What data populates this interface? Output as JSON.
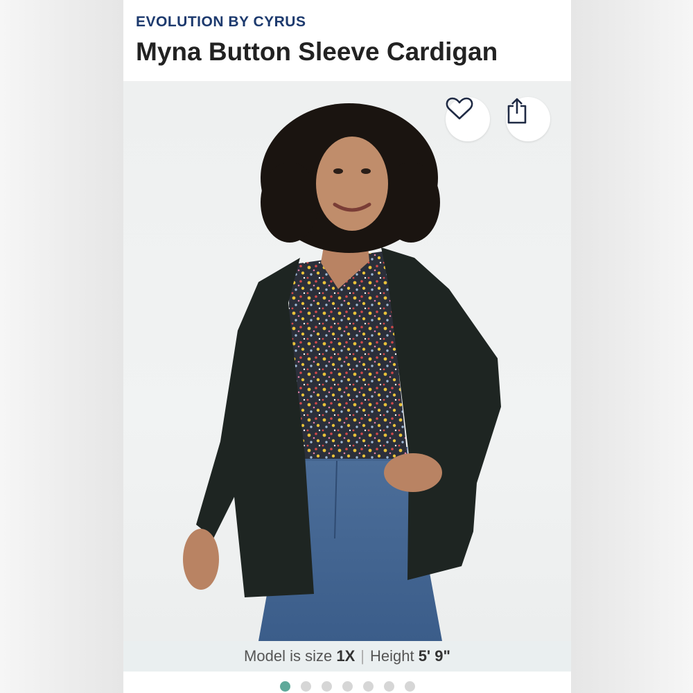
{
  "product": {
    "brand": "EVOLUTION BY CYRUS",
    "title": "Myna Button Sleeve Cardigan"
  },
  "actions": {
    "favorite_icon": "heart-outline-icon",
    "share_icon": "share-upload-icon"
  },
  "model_info": {
    "size_label": "Model is size",
    "size_value": "1X",
    "height_label": "Height",
    "height_value": "5' 9\""
  },
  "carousel": {
    "count": 7,
    "active_index": 0
  },
  "colors": {
    "brand": "#1d3a6e",
    "dot_active": "#5fa99a",
    "dot_inactive": "#d6d6d6",
    "caption_bg": "#eaeff0"
  }
}
